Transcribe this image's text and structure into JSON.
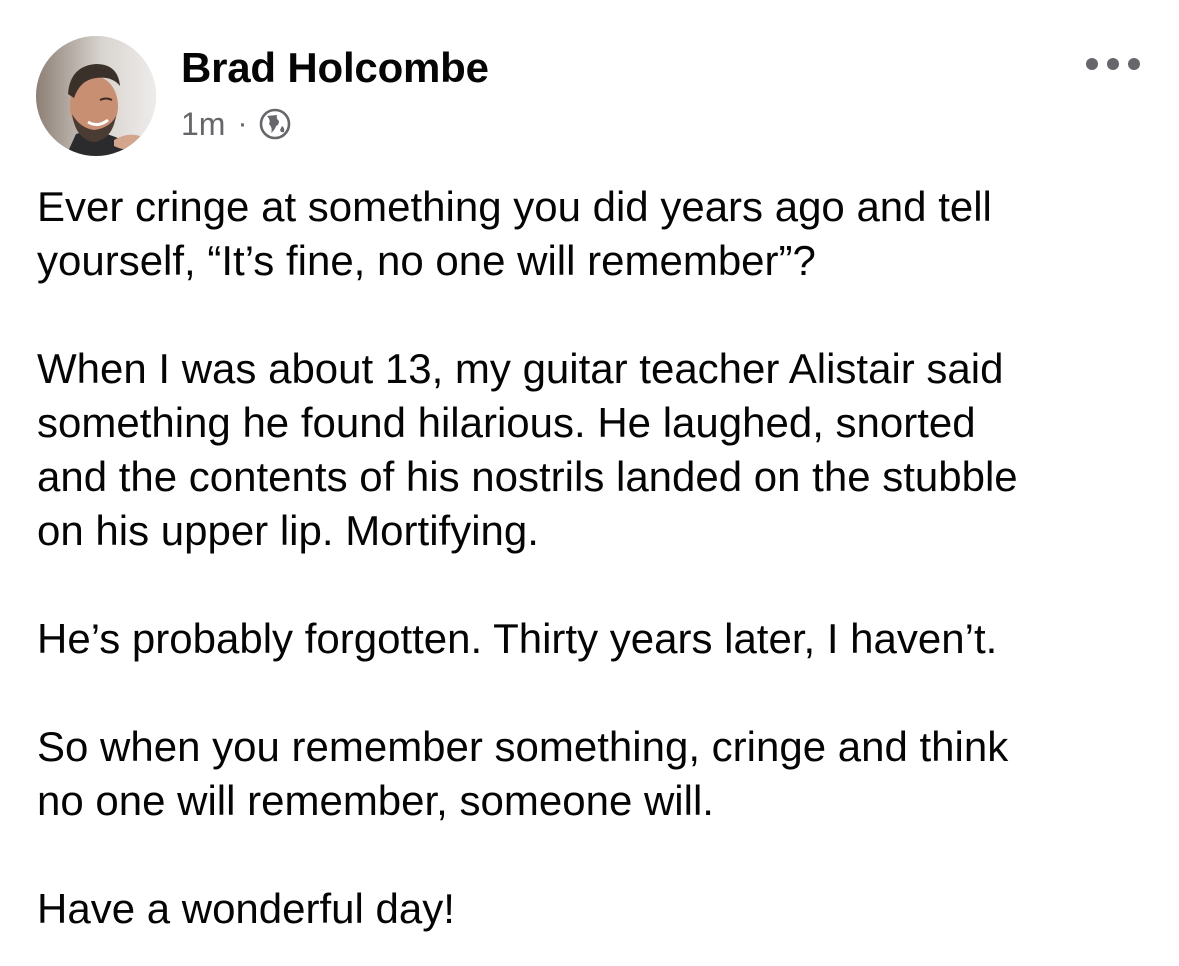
{
  "post": {
    "author": "Brad Holcombe",
    "timestamp": "1m",
    "separator": "·",
    "audience_icon": "globe-icon",
    "menu_icon": "more-options-icon",
    "paragraphs": [
      [
        "Ever cringe at something you did years ago and tell",
        "yourself, “It’s fine, no one will remember”?"
      ],
      [
        "When I was about 13, my guitar teacher Alistair said",
        "something he found hilarious. He laughed, snorted",
        "and the contents of his nostrils landed on the stubble",
        "on his upper lip. Mortifying."
      ],
      [
        "He’s probably forgotten. Thirty years later, I haven’t."
      ],
      [
        "So when you remember something, cringe and think",
        "no one will remember, someone will."
      ],
      [
        "Have a wonderful day!"
      ]
    ]
  },
  "colors": {
    "text": "#050505",
    "secondary": "#65676b",
    "background": "#ffffff"
  }
}
